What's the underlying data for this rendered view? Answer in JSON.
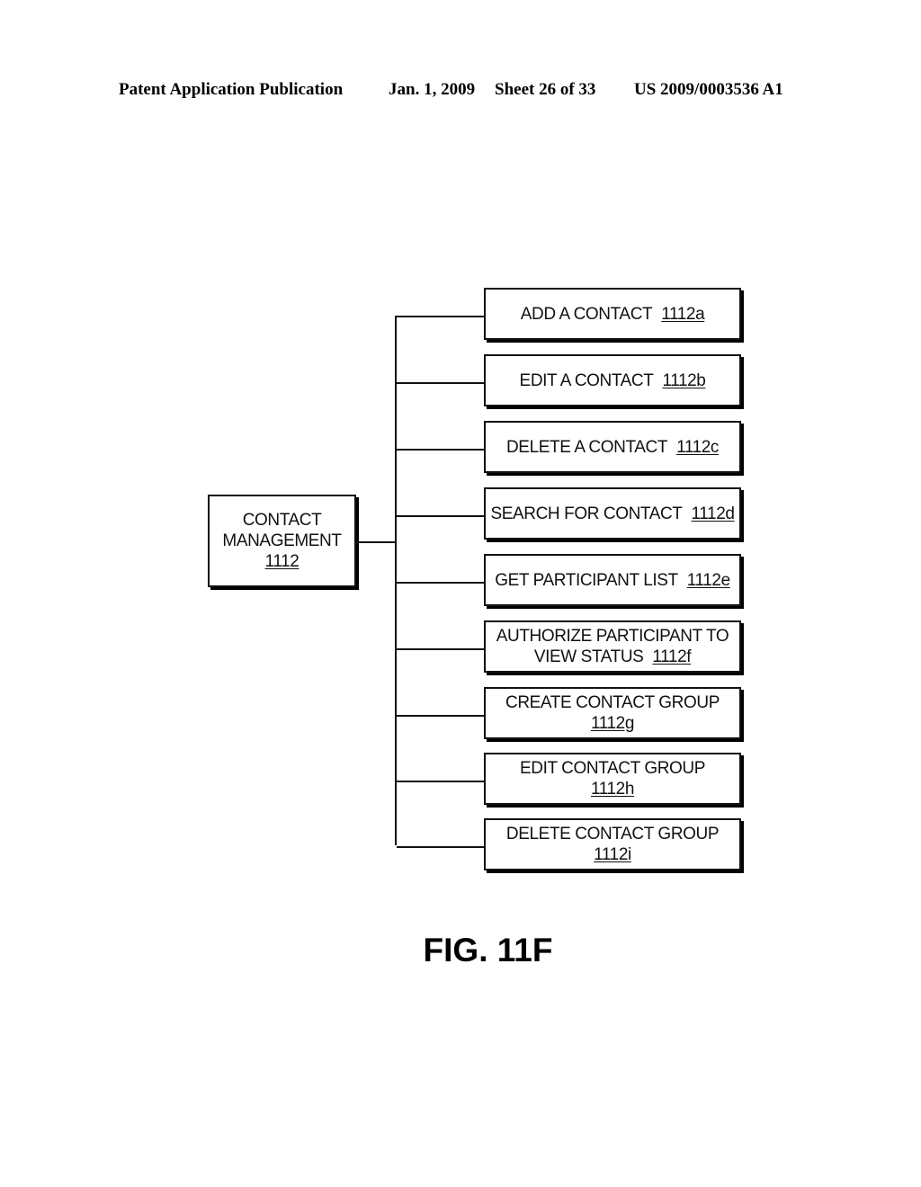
{
  "header": {
    "publication": "Patent Application Publication",
    "date": "Jan. 1, 2009",
    "sheet": "Sheet 26 of 33",
    "number": "US 2009/0003536 A1"
  },
  "root": {
    "line1": "CONTACT",
    "line2": "MANAGEMENT",
    "ref": "1112"
  },
  "children": [
    {
      "text": "ADD A CONTACT",
      "text2": "",
      "ref": "1112a"
    },
    {
      "text": "EDIT A CONTACT",
      "text2": "",
      "ref": "1112b"
    },
    {
      "text": "DELETE A CONTACT",
      "text2": "",
      "ref": "1112c"
    },
    {
      "text": "SEARCH FOR CONTACT",
      "text2": "",
      "ref": "1112d"
    },
    {
      "text": "GET PARTICIPANT LIST",
      "text2": "",
      "ref": "1112e"
    },
    {
      "text": "AUTHORIZE PARTICIPANT TO",
      "text2": "VIEW STATUS",
      "ref": "1112f"
    },
    {
      "text": "CREATE CONTACT GROUP",
      "text2": "",
      "ref": "1112g"
    },
    {
      "text": "EDIT CONTACT GROUP",
      "text2": "",
      "ref": "1112h"
    },
    {
      "text": "DELETE CONTACT GROUP",
      "text2": "",
      "ref": "1112i"
    }
  ],
  "figure_label": "FIG. 11F"
}
